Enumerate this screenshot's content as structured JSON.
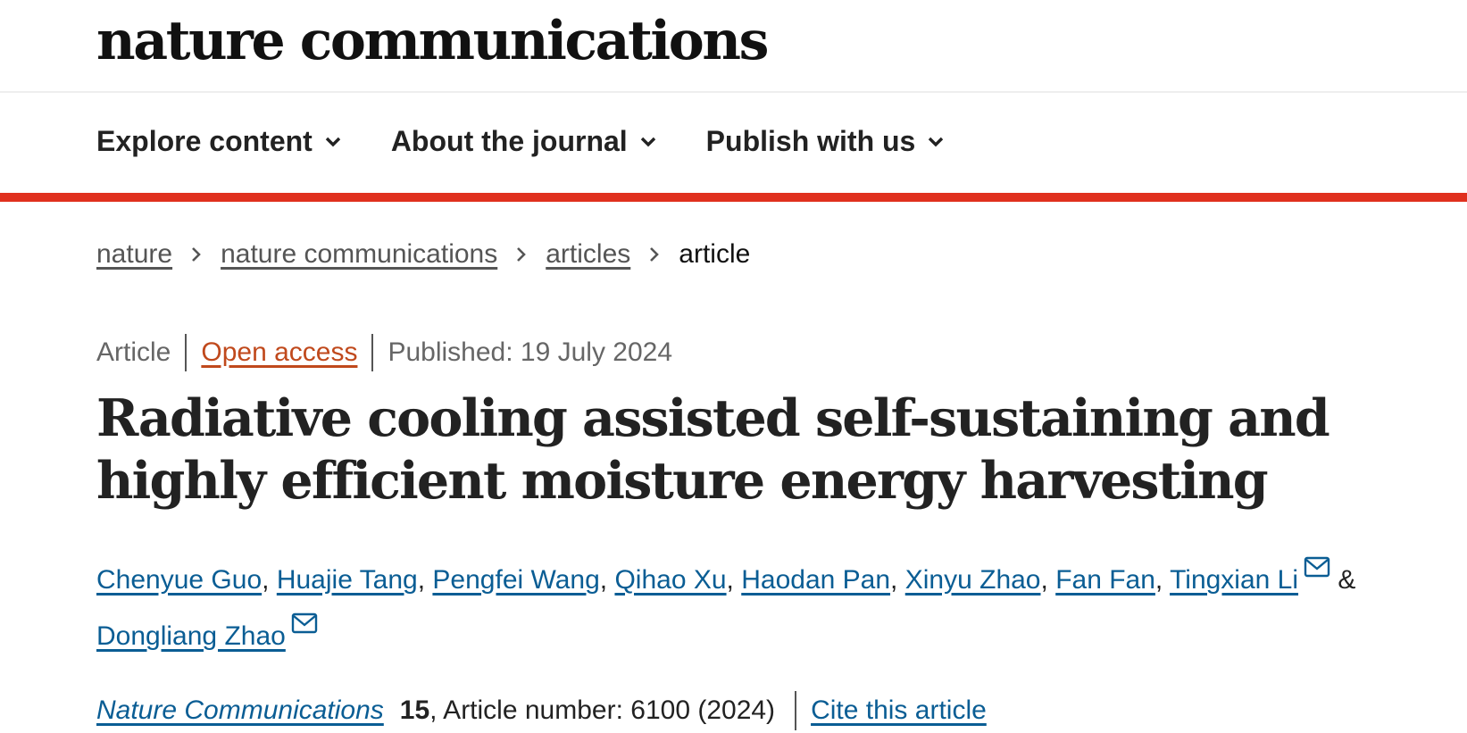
{
  "site": {
    "logo": "nature communications"
  },
  "nav": {
    "items": [
      {
        "label": "Explore content"
      },
      {
        "label": "About the journal"
      },
      {
        "label": "Publish with us"
      }
    ]
  },
  "breadcrumb": {
    "links": [
      "nature",
      "nature communications",
      "articles"
    ],
    "current": "article"
  },
  "meta": {
    "type": "Article",
    "access": "Open access",
    "published": "Published: 19 July 2024"
  },
  "article": {
    "title": "Radiative cooling assisted self-sustaining and highly efficient moisture energy harvesting",
    "authors": [
      {
        "name": "Chenyue Guo",
        "email": false
      },
      {
        "name": "Huajie Tang",
        "email": false
      },
      {
        "name": "Pengfei Wang",
        "email": false
      },
      {
        "name": "Qihao Xu",
        "email": false
      },
      {
        "name": "Haodan Pan",
        "email": false
      },
      {
        "name": "Xinyu Zhao",
        "email": false
      },
      {
        "name": "Fan Fan",
        "email": false
      },
      {
        "name": "Tingxian Li",
        "email": true
      },
      {
        "name": "Dongliang Zhao",
        "email": true
      }
    ],
    "author_separator": ", ",
    "author_last_separator": " & "
  },
  "citation": {
    "journal": "Nature Communications",
    "volume": "15",
    "details": ", Article number: 6100 (2024)",
    "cite_label": "Cite this article"
  },
  "colors": {
    "accent_bar": "#e0301e",
    "link": "#0a5d94",
    "open_access": "#c0491c"
  },
  "icons": {
    "nav_chevron": "chevron-down-icon",
    "breadcrumb_separator": "chevron-right-icon",
    "author_email": "envelope-icon"
  }
}
